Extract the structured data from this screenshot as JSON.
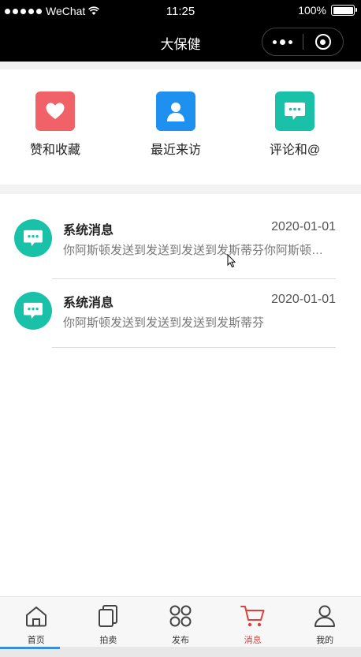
{
  "status_bar": {
    "carrier": "WeChat",
    "time": "11:25",
    "battery": "100%",
    "battery_level": 1.0
  },
  "nav": {
    "title": "大保健"
  },
  "quick_entries": [
    {
      "label": "赞和收藏",
      "icon": "heart-icon",
      "color": "#f06268"
    },
    {
      "label": "最近来访",
      "icon": "person-icon",
      "color": "#1e90f0"
    },
    {
      "label": "评论和@",
      "icon": "chat-bubble-icon",
      "color": "#18c1a8"
    }
  ],
  "messages": [
    {
      "name": "系统消息",
      "date": "2020-01-01",
      "preview": "你阿斯顿发送到发送到发送到发斯蒂芬你阿斯顿发送到",
      "icon": "chat-bubble-icon"
    },
    {
      "name": "系统消息",
      "date": "2020-01-01",
      "preview": "你阿斯顿发送到发送到发送到发斯蒂芬",
      "icon": "chat-bubble-icon"
    }
  ],
  "tabbar": {
    "active": "消息",
    "accent": "#e0403c",
    "tabs": [
      {
        "label": "首页",
        "icon": "home-icon"
      },
      {
        "label": "拍卖",
        "icon": "cards-icon"
      },
      {
        "label": "发布",
        "icon": "grid-icon"
      },
      {
        "label": "消息",
        "icon": "cart-icon"
      },
      {
        "label": "我的",
        "icon": "user-icon"
      }
    ]
  }
}
